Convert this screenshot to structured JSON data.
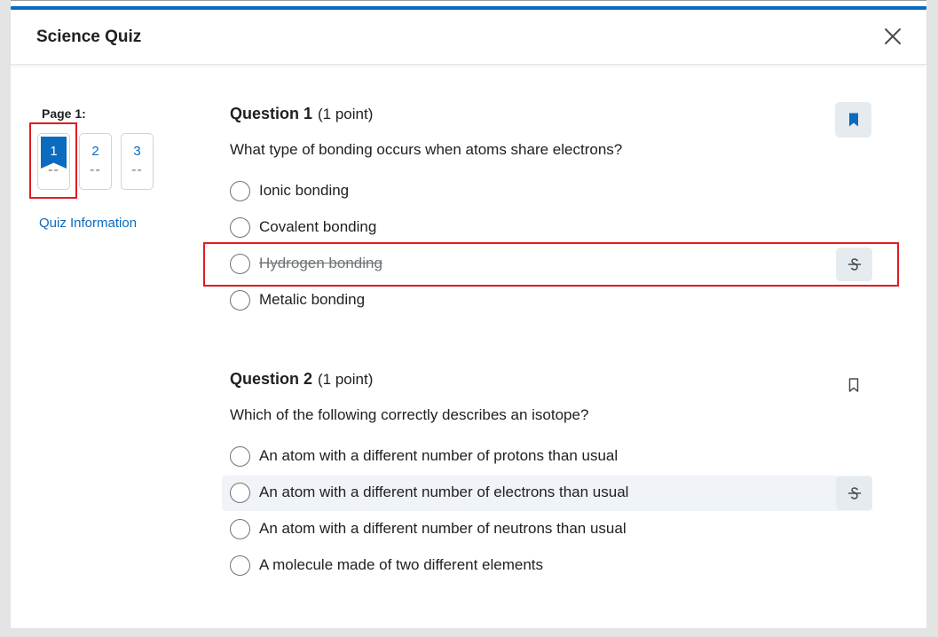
{
  "dialog": {
    "title": "Science Quiz",
    "close_icon": "close-icon"
  },
  "nav": {
    "page_label": "Page 1:",
    "pages": [
      {
        "number": "1",
        "status": "--",
        "current": true
      },
      {
        "number": "2",
        "status": "--",
        "current": false
      },
      {
        "number": "3",
        "status": "--",
        "current": false
      }
    ],
    "quiz_info_link": "Quiz Information"
  },
  "questions": [
    {
      "title": "Question 1",
      "points": "(1 point)",
      "text": "What type of bonding occurs when atoms share electrons?",
      "bookmarked": true,
      "options": [
        {
          "label": "Ionic bonding",
          "struck": false
        },
        {
          "label": "Covalent bonding",
          "struck": false
        },
        {
          "label": "Hydrogen bonding",
          "struck": true
        },
        {
          "label": "Metalic bonding",
          "struck": false
        }
      ]
    },
    {
      "title": "Question 2",
      "points": "(1 point)",
      "text": "Which of the following correctly describes an isotope?",
      "bookmarked": false,
      "options": [
        {
          "label": "An atom with a different number of protons than usual",
          "struck": false
        },
        {
          "label": "An atom with a different number of electrons than usual",
          "struck": false
        },
        {
          "label": "An atom with a different number of neutrons than usual",
          "struck": false
        },
        {
          "label": "A molecule made of two different elements",
          "struck": false
        }
      ]
    }
  ],
  "colors": {
    "accent": "#0a6bbf",
    "highlight_box": "#e11b22",
    "hover_row": "#f0f4f9"
  }
}
